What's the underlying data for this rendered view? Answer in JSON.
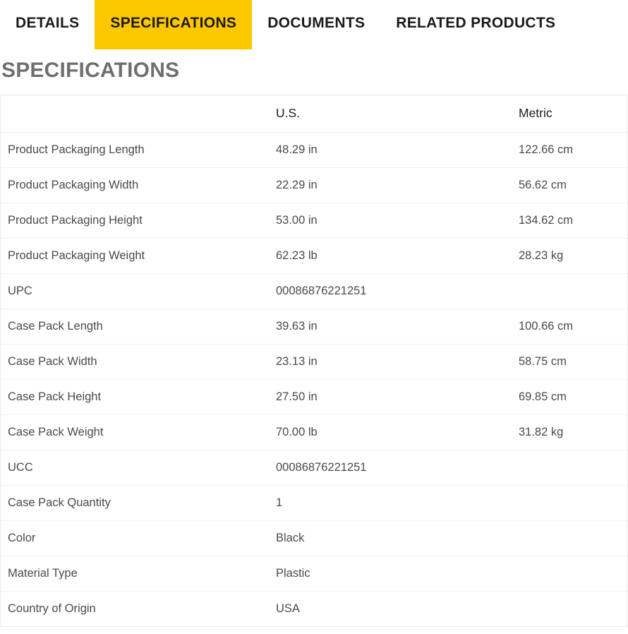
{
  "tabs": [
    {
      "label": "DETAILS",
      "active": false
    },
    {
      "label": "SPECIFICATIONS",
      "active": true
    },
    {
      "label": "DOCUMENTS",
      "active": false
    },
    {
      "label": "RELATED PRODUCTS",
      "active": false
    }
  ],
  "page": {
    "title": "SPECIFICATIONS"
  },
  "colors": {
    "active_tab_background": "#FDC800",
    "tab_text": "#1A1A1A",
    "heading_text": "#6F6F6F",
    "cell_text": "#4A4A4A",
    "row_divider": "#F0F0F0",
    "table_border": "#ECECEC",
    "page_background": "#FFFFFF"
  },
  "spec_table": {
    "columns": [
      "",
      "U.S.",
      "Metric"
    ],
    "rows": [
      {
        "label": "Product Packaging Length",
        "us": "48.29 in",
        "metric": "122.66 cm"
      },
      {
        "label": "Product Packaging Width",
        "us": "22.29 in",
        "metric": "56.62 cm"
      },
      {
        "label": "Product Packaging Height",
        "us": "53.00 in",
        "metric": "134.62 cm"
      },
      {
        "label": "Product Packaging Weight",
        "us": "62.23 lb",
        "metric": "28.23 kg"
      },
      {
        "label": "UPC",
        "us": "00086876221251",
        "metric": ""
      },
      {
        "label": "Case Pack Length",
        "us": "39.63 in",
        "metric": "100.66 cm"
      },
      {
        "label": "Case Pack Width",
        "us": "23.13 in",
        "metric": "58.75 cm"
      },
      {
        "label": "Case Pack Height",
        "us": "27.50 in",
        "metric": "69.85 cm"
      },
      {
        "label": "Case Pack Weight",
        "us": "70.00 lb",
        "metric": "31.82 kg"
      },
      {
        "label": "UCC",
        "us": "00086876221251",
        "metric": ""
      },
      {
        "label": "Case Pack Quantity",
        "us": "1",
        "metric": ""
      },
      {
        "label": "Color",
        "us": "Black",
        "metric": ""
      },
      {
        "label": "Material Type",
        "us": "Plastic",
        "metric": ""
      },
      {
        "label": "Country of Origin",
        "us": "USA",
        "metric": ""
      }
    ]
  }
}
